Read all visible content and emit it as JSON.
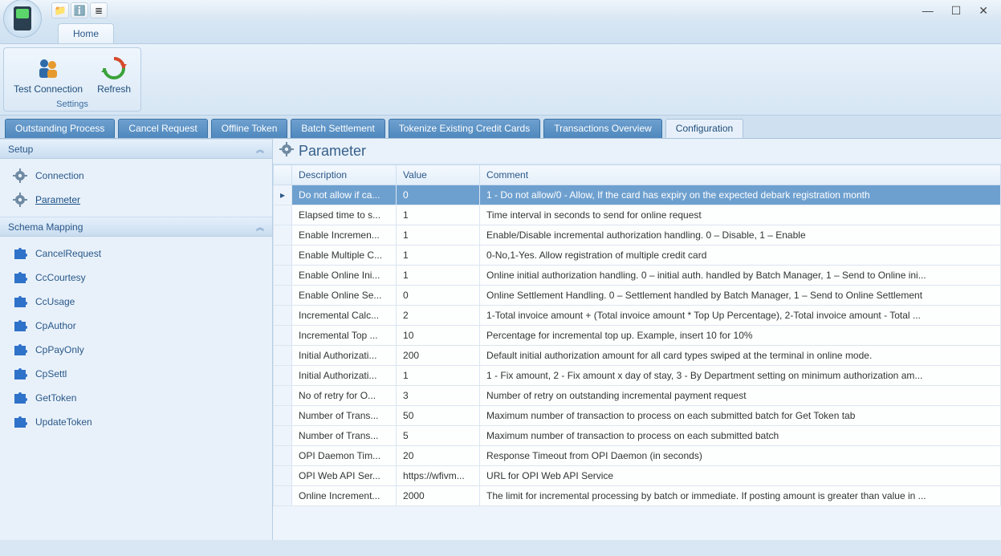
{
  "ribbon": {
    "home": "Home",
    "groupName": "Settings",
    "testConn": "Test Connection",
    "refresh": "Refresh"
  },
  "mainTabs": [
    "Outstanding Process",
    "Cancel Request",
    "Offline Token",
    "Batch Settlement",
    "Tokenize Existing Credit Cards",
    "Transactions Overview",
    "Configuration"
  ],
  "sidebar": {
    "setupHeader": "Setup",
    "setupItems": [
      "Connection",
      "Parameter"
    ],
    "schemaHeader": "Schema Mapping",
    "schemaItems": [
      "CancelRequest",
      "CcCourtesy",
      "CcUsage",
      "CpAuthor",
      "CpPayOnly",
      "CpSettl",
      "GetToken",
      "UpdateToken"
    ]
  },
  "content": {
    "title": "Parameter",
    "columns": [
      "Description",
      "Value",
      "Comment"
    ],
    "rows": [
      {
        "desc": "Do not allow if ca...",
        "val": "0",
        "comment": "1 - Do not allow/0 - Allow, If the card has expiry on the expected debark registration month"
      },
      {
        "desc": "Elapsed time to s...",
        "val": "1",
        "comment": "Time interval in seconds to send for online request"
      },
      {
        "desc": "Enable Incremen...",
        "val": "1",
        "comment": "Enable/Disable incremental authorization handling.  0 – Disable, 1 – Enable"
      },
      {
        "desc": "Enable Multiple C...",
        "val": "1",
        "comment": "0-No,1-Yes. Allow registration of multiple credit card"
      },
      {
        "desc": "Enable Online Ini...",
        "val": "1",
        "comment": "Online initial authorization handling.  0 – initial auth. handled by Batch Manager, 1 – Send to Online ini..."
      },
      {
        "desc": "Enable Online Se...",
        "val": "0",
        "comment": "Online Settlement Handling.  0 – Settlement handled by Batch Manager, 1 – Send to Online Settlement"
      },
      {
        "desc": "Incremental Calc...",
        "val": "2",
        "comment": "1-Total invoice amount + (Total invoice amount * Top Up Percentage), 2-Total invoice amount - Total ..."
      },
      {
        "desc": "Incremental Top ...",
        "val": "10",
        "comment": "Percentage for incremental top up. Example, insert 10 for 10%"
      },
      {
        "desc": "Initial Authorizati...",
        "val": "200",
        "comment": "Default initial authorization amount for all card types swiped at the terminal in online mode."
      },
      {
        "desc": "Initial Authorizati...",
        "val": "1",
        "comment": "1 - Fix amount, 2 - Fix amount x day of stay, 3 - By Department setting on minimum authorization am..."
      },
      {
        "desc": "No of retry for O...",
        "val": "3",
        "comment": "Number of retry on outstanding incremental payment request"
      },
      {
        "desc": "Number of Trans...",
        "val": "50",
        "comment": "Maximum number of transaction to process on each submitted batch for Get Token tab"
      },
      {
        "desc": "Number of Trans...",
        "val": "5",
        "comment": "Maximum number of transaction to process on each submitted batch"
      },
      {
        "desc": "OPI Daemon Tim...",
        "val": "20",
        "comment": "Response Timeout from OPI Daemon (in seconds)"
      },
      {
        "desc": "OPI Web API Ser...",
        "val": "https://wfivm...",
        "comment": "URL for OPI Web API Service"
      },
      {
        "desc": "Online Increment...",
        "val": "2000",
        "comment": "The limit for incremental processing by batch or immediate. If posting amount is greater than value in ..."
      }
    ]
  }
}
